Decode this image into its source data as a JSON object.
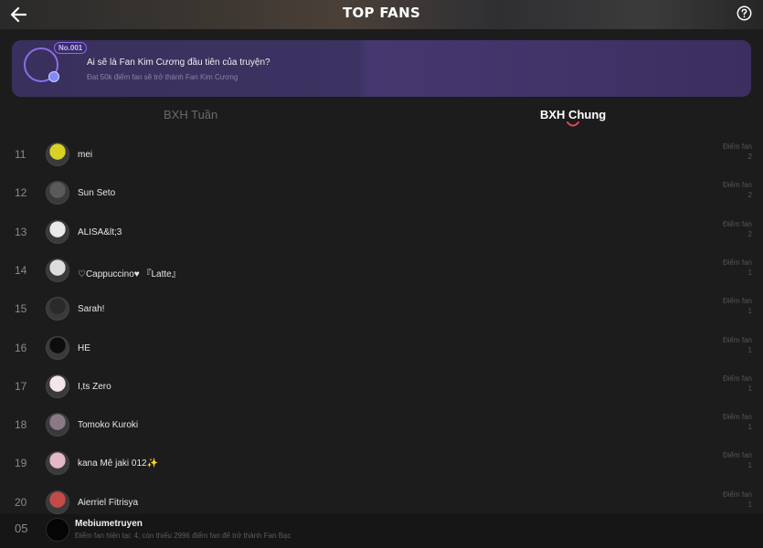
{
  "header": {
    "title": "TOP FANS",
    "back_icon": "arrow-left-icon",
    "help_icon": "question-circle-icon"
  },
  "banner": {
    "badge": "No.001",
    "question": "Ai sẽ là Fan Kim Cương đầu tiên của truyện?",
    "subtitle": "Đạt 50k điểm fan sẽ trở thành Fan Kim Cương"
  },
  "tabs": {
    "weekly": "BXH Tuần",
    "overall": "BXH Chung",
    "active": "overall",
    "accent_color": "#e8455a"
  },
  "points_label": "Điểm fan",
  "fans": [
    {
      "rank": "11",
      "name": "mei",
      "points": "2"
    },
    {
      "rank": "12",
      "name": "Sun Seto",
      "points": "2"
    },
    {
      "rank": "13",
      "name": "ALISA&lt;3",
      "points": "2"
    },
    {
      "rank": "14",
      "name": "♡Cappuccino♥ 『Latte』",
      "points": "1"
    },
    {
      "rank": "15",
      "name": "Sarah!",
      "points": "1"
    },
    {
      "rank": "16",
      "name": "HE",
      "points": "1"
    },
    {
      "rank": "17",
      "name": "I,ts Zero",
      "points": "1"
    },
    {
      "rank": "18",
      "name": "Tomoko Kuroki",
      "points": "1"
    },
    {
      "rank": "19",
      "name": "kana Mê jaki 012✨",
      "points": "1"
    },
    {
      "rank": "20",
      "name": "Aierriel Fitrisya",
      "points": "1"
    }
  ],
  "my_rank": {
    "rank": "05",
    "name": "Mebiumetruyen",
    "info": "Điểm fan hiện tại: 4, còn thiếu 2996 điểm fan để trở thành Fan Bạc"
  }
}
